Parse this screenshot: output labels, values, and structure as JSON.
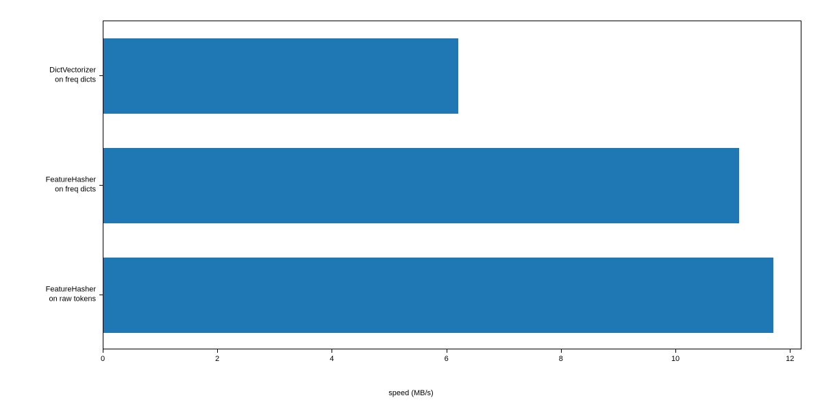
{
  "chart_data": {
    "type": "bar",
    "orientation": "horizontal",
    "categories": [
      "DictVectorizer\non freq dicts",
      "FeatureHasher\non freq dicts",
      "FeatureHasher\non raw tokens"
    ],
    "values": [
      6.2,
      11.1,
      11.7
    ],
    "xlabel": "speed (MB/s)",
    "ylabel": "",
    "title": "",
    "xlim": [
      0,
      12.2
    ],
    "x_ticks": [
      0,
      2,
      4,
      6,
      8,
      10,
      12
    ],
    "x_tick_labels": [
      "0",
      "2",
      "4",
      "6",
      "8",
      "10",
      "12"
    ],
    "bar_color": "#1f77b4"
  }
}
